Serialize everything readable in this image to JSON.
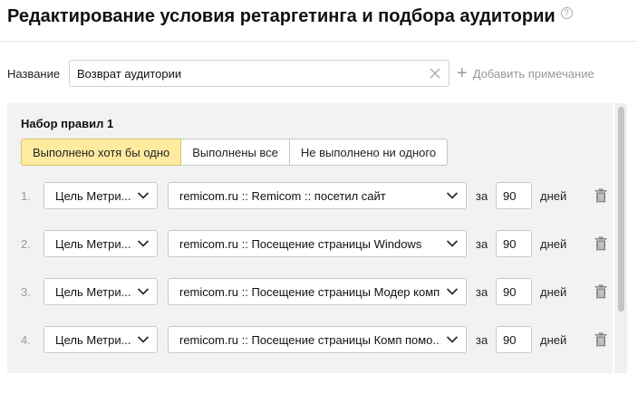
{
  "header": {
    "title": "Редактирование условия ретаргетинга и подбора аудитории",
    "help_icon": "?"
  },
  "name_field": {
    "label": "Название",
    "value": "Возврат аудитории",
    "add_note_label": "Добавить примечание"
  },
  "ruleset": {
    "title": "Набор правил",
    "number": "1",
    "modes": [
      {
        "label": "Выполнено хотя бы одно",
        "active": true
      },
      {
        "label": "Выполнены все",
        "active": false
      },
      {
        "label": "Не выполнено ни одного",
        "active": false
      }
    ],
    "rules": [
      {
        "num": "1.",
        "type": "Цель Метри...",
        "goal": "remicom.ru :: Remicom :: посетил сайт",
        "za": "за",
        "days": "90",
        "days_label": "дней"
      },
      {
        "num": "2.",
        "type": "Цель Метри...",
        "goal": "remicom.ru :: Посещение страницы Windows",
        "za": "за",
        "days": "90",
        "days_label": "дней"
      },
      {
        "num": "3.",
        "type": "Цель Метри...",
        "goal": "remicom.ru :: Посещение страницы Модер комп",
        "za": "за",
        "days": "90",
        "days_label": "дней"
      },
      {
        "num": "4.",
        "type": "Цель Метри...",
        "goal": "remicom.ru :: Посещение страницы Комп помо...",
        "za": "за",
        "days": "90",
        "days_label": "дней"
      }
    ]
  },
  "colors": {
    "active_segment": "#ffeba0",
    "panel_background": "#f2f2f2"
  }
}
